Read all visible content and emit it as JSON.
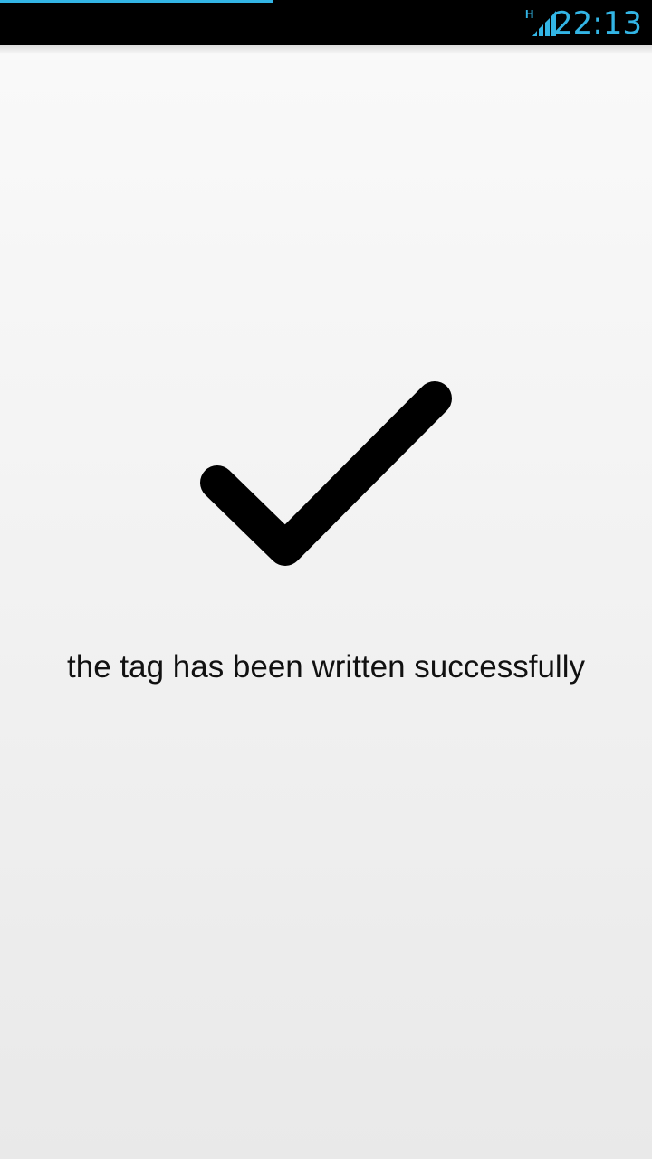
{
  "status_bar": {
    "network_type": "H",
    "time": "22:13",
    "accent_color": "#33b5e5",
    "progress": 0.42,
    "signal_icon": "signal-strength-icon"
  },
  "main": {
    "icon": "checkmark-icon",
    "message": "the tag has been written successfully"
  }
}
